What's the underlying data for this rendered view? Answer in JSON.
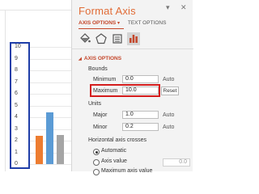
{
  "chart": {
    "y_ticks": [
      "10",
      "9",
      "8",
      "7",
      "6",
      "5",
      "4",
      "3",
      "2",
      "1",
      "0"
    ],
    "bars": [
      {
        "series": "orange",
        "value": 2.4,
        "color": "#ed7d31"
      },
      {
        "series": "blue",
        "value": 4.4,
        "color": "#5b9bd5"
      },
      {
        "series": "gray",
        "value": 2.5,
        "color": "#a5a5a5"
      }
    ],
    "ymax": 10
  },
  "pane": {
    "title": "Format Axis",
    "dropdown_glyph": "▾",
    "close_glyph": "✕",
    "tabs": {
      "axis_options": "AXIS OPTIONS",
      "text_options": "TEXT OPTIONS",
      "caret": "▾"
    },
    "icons": [
      "paint-bucket-icon",
      "pentagon-icon",
      "size-properties-icon",
      "bar-chart-icon"
    ],
    "section": {
      "caret": "◢",
      "title": "AXIS OPTIONS"
    },
    "bounds": {
      "heading": "Bounds",
      "minimum_label": "Minimum",
      "minimum_value": "0.0",
      "minimum_mode": "Auto",
      "maximum_label": "Maximum",
      "maximum_value": "10.0",
      "reset_label": "Reset"
    },
    "units": {
      "heading": "Units",
      "major_label": "Major",
      "major_value": "1.0",
      "major_mode": "Auto",
      "minor_label": "Minor",
      "minor_value": "0.2",
      "minor_mode": "Auto"
    },
    "crosses": {
      "heading": "Horizontal axis crosses",
      "option_automatic": "Automatic",
      "option_axis_value": "Axis value",
      "axis_value": "0.0",
      "option_maximum": "Maximum axis value"
    },
    "accent_color": "#c4462a",
    "title_color": "#e16c37"
  }
}
